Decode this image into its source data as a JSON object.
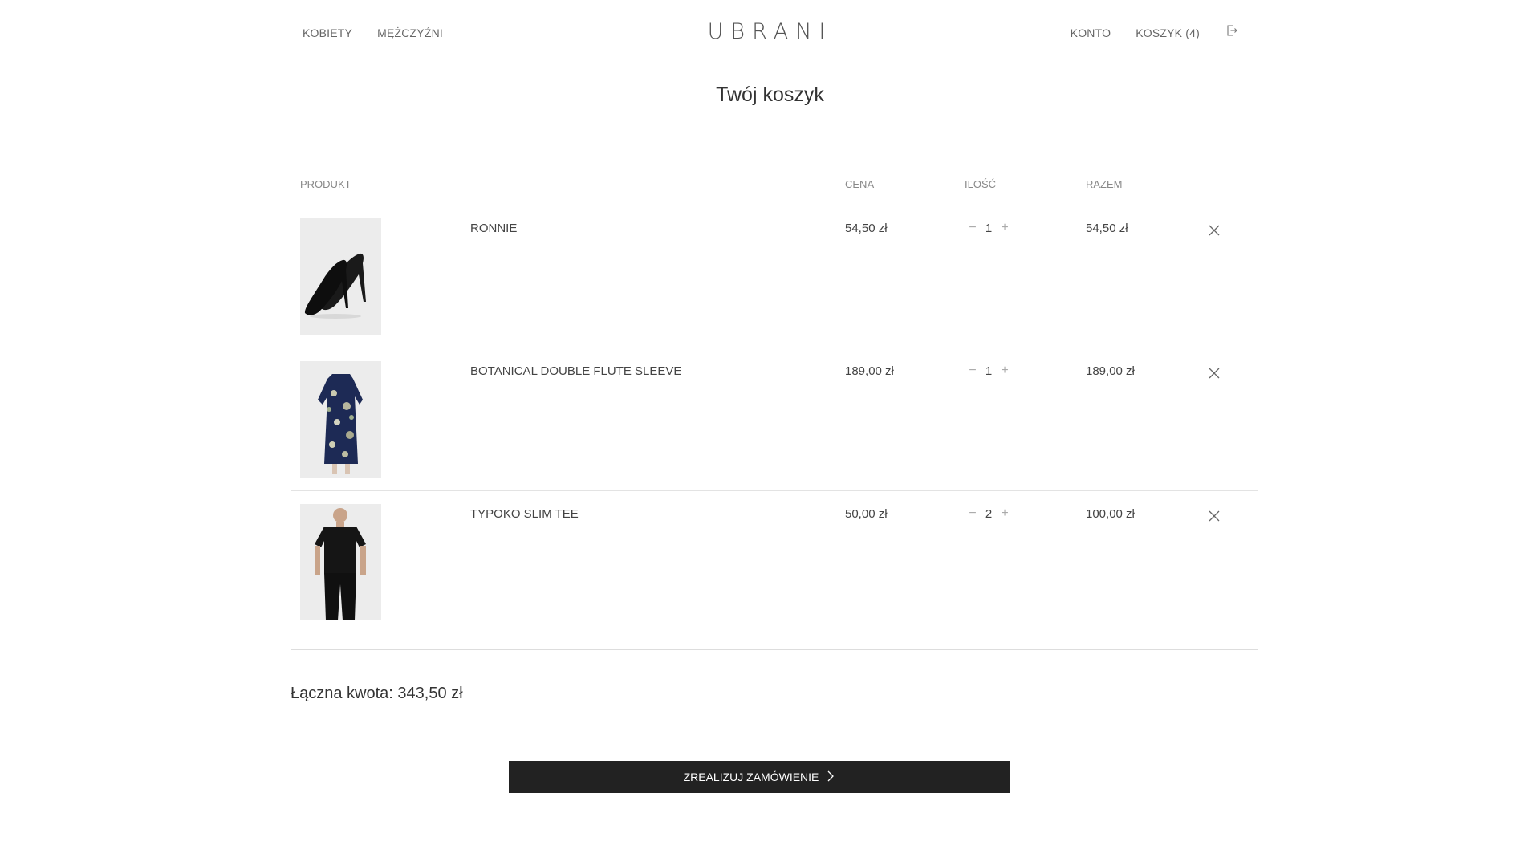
{
  "header": {
    "nav_left": [
      {
        "label": "KOBIETY"
      },
      {
        "label": "MĘŻCZYŹNI"
      }
    ],
    "logo": "UBRANI",
    "nav_right": [
      {
        "label": "KONTO"
      },
      {
        "label": "KOSZYK (4)"
      }
    ],
    "logout_icon": "logout-icon"
  },
  "page_title": "Twój koszyk",
  "table": {
    "headers": {
      "product": "PRODUKT",
      "price": "CENA",
      "quantity": "ILOŚĆ",
      "total": "RAZEM"
    },
    "rows": [
      {
        "name": "RONNIE",
        "price": "54,50 zł",
        "quantity": "1",
        "total": "54,50 zł",
        "image": "black-heels-image"
      },
      {
        "name": "BOTANICAL DOUBLE FLUTE SLEEVE",
        "price": "189,00 zł",
        "quantity": "1",
        "total": "189,00 zł",
        "image": "floral-dress-image"
      },
      {
        "name": "TYPOKO SLIM TEE",
        "price": "50,00 zł",
        "quantity": "2",
        "total": "100,00 zł",
        "image": "black-tee-image"
      }
    ]
  },
  "summary": {
    "total_text": "Łączna kwota: 343,50 zł"
  },
  "checkout": {
    "label": "ZREALIZUJ ZAMÓWIENIE"
  },
  "colors": {
    "button_bg": "#222222",
    "divider": "#e3e3e3",
    "text": "#444444"
  }
}
